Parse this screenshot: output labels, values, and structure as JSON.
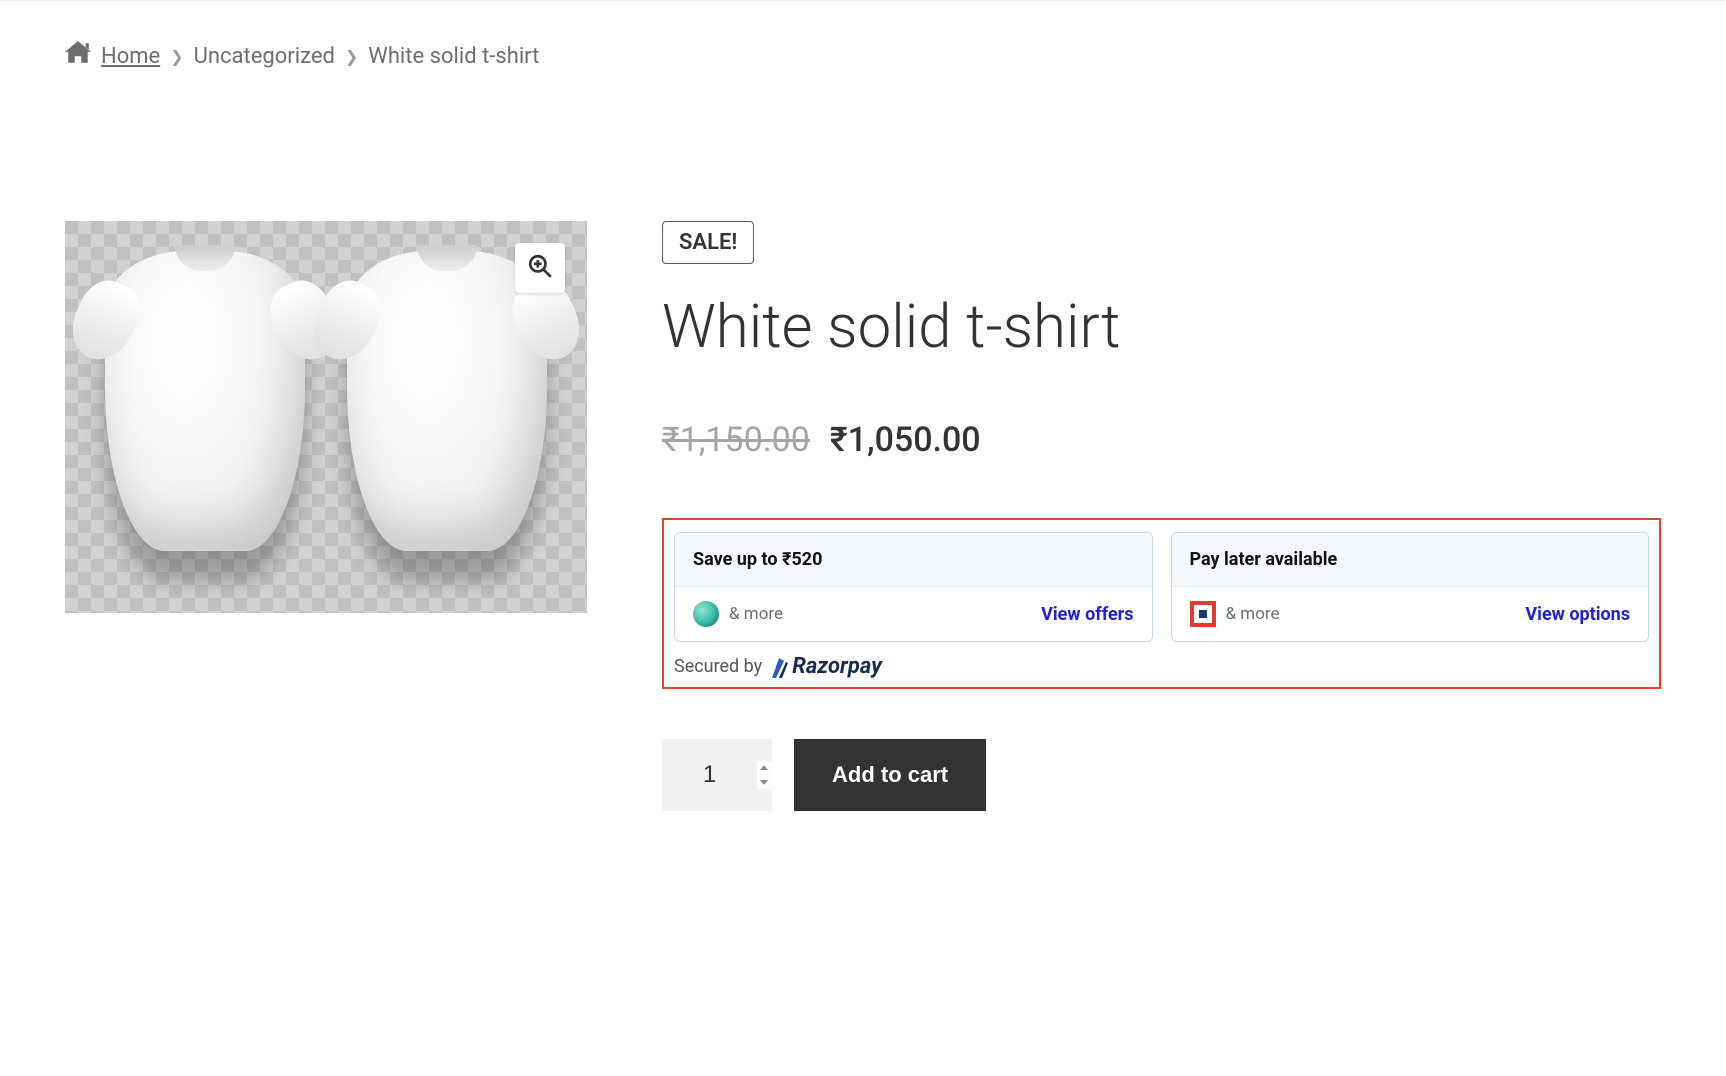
{
  "breadcrumb": {
    "home": "Home",
    "category": "Uncategorized",
    "current": "White solid t-shirt"
  },
  "product": {
    "sale_badge": "SALE!",
    "title": "White solid t-shirt",
    "price_old": "₹1,150.00",
    "price_new": "₹1,050.00",
    "quantity": "1",
    "add_to_cart": "Add to cart"
  },
  "offers": {
    "save_card": {
      "title": "Save up to ₹520",
      "more": "& more",
      "link": "View offers"
    },
    "paylater_card": {
      "title": "Pay later available",
      "more": "& more",
      "link": "View options"
    },
    "secured_by": "Secured by",
    "provider_name": "Razorpay"
  }
}
